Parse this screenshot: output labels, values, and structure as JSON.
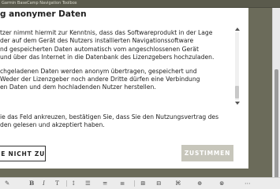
{
  "window": {
    "title": "Garmin BaseCamp Navigation Toolbox"
  },
  "dialog": {
    "heading": "g anonymer Daten",
    "paragraph1": [
      "tzer nimmt hiermit zur Kenntnis, dass das Softwareprodukt in der Lage",
      "der auf dem Gerät des Nutzers installierten Navigationssoftware",
      "nd gespeicherten Daten automatisch vom angeschlossenen Gerät",
      "und über das Internet in die Datenbank des Lizenzgebers hochzuladen."
    ],
    "paragraph2": [
      "chgeladenen Daten werden anonym übertragen, gespeichert und",
      "Weder der Lizenzgeber noch andere Dritte dürfen eine Verbindung",
      "en Daten und dem hochladenden Nutzer herstellen."
    ],
    "consent": [
      "ie das Feld ankreuzen, bestätigen Sie, dass Sie den Nutzungsvertrag des",
      "den gelesen und akzeptiert haben."
    ],
    "decline_label": "ME NICHT ZU",
    "accept_label": "ZUSTIMMEN"
  },
  "toolbar": {
    "items": [
      "✎",
      "B",
      "I",
      "T",
      "↕",
      "☰",
      "≡",
      "≣",
      "⊞",
      "⊟",
      "⌘",
      "⊕",
      "⊗",
      "⋯"
    ]
  },
  "colors": {
    "accept_button": "#c7c6bb",
    "background": "#6b6b5a"
  }
}
